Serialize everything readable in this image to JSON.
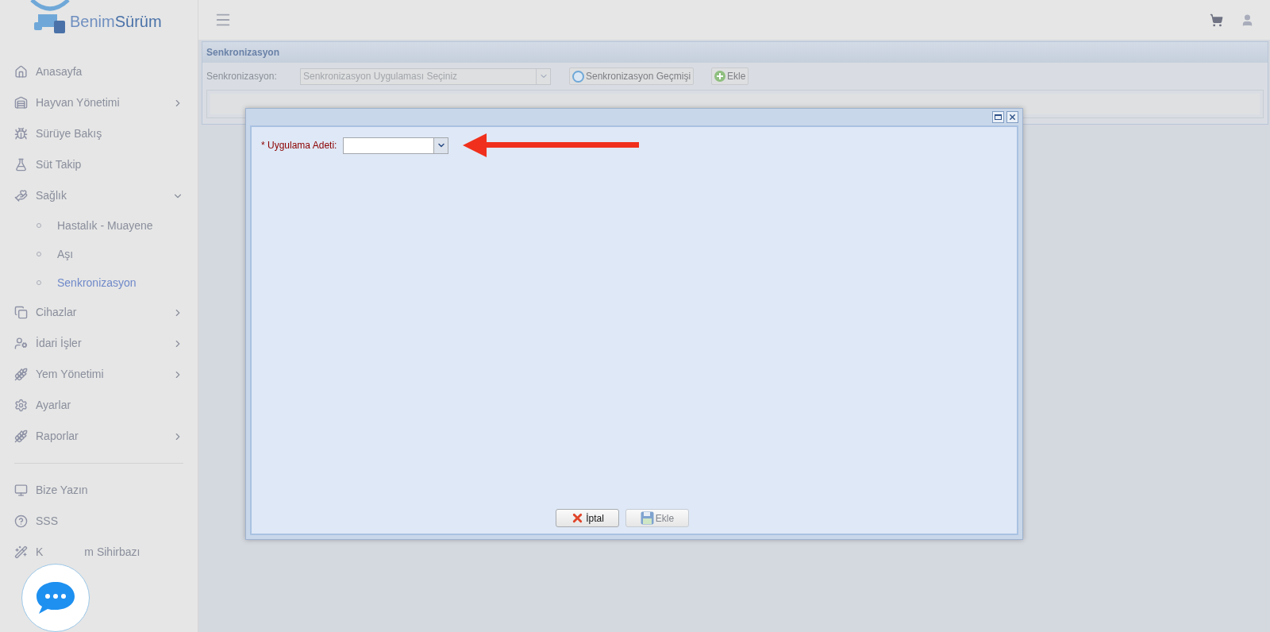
{
  "logo": {
    "text_a": "Benim",
    "text_b": "Sürüm"
  },
  "sidebar": {
    "items": [
      {
        "label": "Anasayfa"
      },
      {
        "label": "Hayvan Yönetimi",
        "expanded": false
      },
      {
        "label": "Sürüye Bakış"
      },
      {
        "label": "Süt Takip"
      },
      {
        "label": "Sağlık",
        "expanded": true,
        "children": [
          {
            "label": "Hastalık - Muayene",
            "selected": false
          },
          {
            "label": "Aşı",
            "selected": false
          },
          {
            "label": "Senkronizasyon",
            "selected": true
          }
        ]
      },
      {
        "label": "Cihazlar",
        "expanded": false
      },
      {
        "label": "İdari İşler",
        "expanded": false
      },
      {
        "label": "Yem Yönetimi",
        "expanded": false
      },
      {
        "label": "Ayarlar"
      },
      {
        "label": "Raporlar",
        "expanded": false
      }
    ],
    "footer_items": [
      {
        "label": "Bize Yazın"
      },
      {
        "label": "SSS"
      },
      {
        "label": "K",
        "label_rest": "m Sihirbazı"
      }
    ]
  },
  "panel": {
    "title": "Senkronizasyon",
    "field_label": "Senkronizasyon:",
    "select_placeholder": "Senkronizasyon Uygulaması Seçiniz",
    "buttons": [
      {
        "label": "Senkronizasyon Geçmişi",
        "kind": "history"
      },
      {
        "label": "Ekle",
        "kind": "add"
      }
    ]
  },
  "dialog": {
    "field_label": "* Uygulama Adeti:",
    "buttons": [
      {
        "label": "İptal",
        "kind": "cancel",
        "disabled": false
      },
      {
        "label": "Ekle",
        "kind": "save",
        "disabled": true
      }
    ]
  }
}
